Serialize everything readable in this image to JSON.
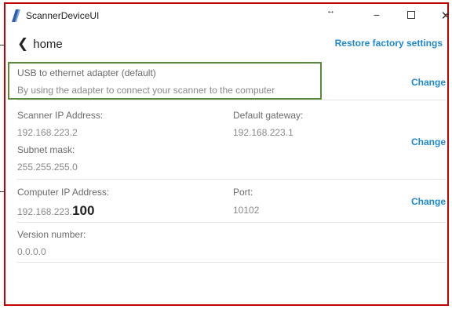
{
  "window": {
    "title": "ScannerDeviceUI",
    "resize_glyph": "↔",
    "minimize_glyph": "−",
    "maximize_glyph": "☐",
    "close_glyph": "✕",
    "icon": "app-logo-icon"
  },
  "nav": {
    "back_label": "home",
    "restore_label": "Restore factory settings"
  },
  "adapter": {
    "title": "USB to ethernet adapter (default)",
    "description": "By using the adapter to connect your scanner to the computer",
    "change_label": "Change"
  },
  "scanner": {
    "ip_label": "Scanner IP Address:",
    "ip_value": "192.168.223.2",
    "gateway_label": "Default gateway:",
    "gateway_value": "192.168.223.1",
    "subnet_label": "Subnet mask:",
    "subnet_value": "255.255.255.0",
    "change_label": "Change"
  },
  "computer": {
    "ip_label": "Computer IP Address:",
    "ip_prefix": "192.168.223.",
    "ip_suffix": "100",
    "port_label": "Port:",
    "port_value": "10102",
    "change_label": "Change"
  },
  "version": {
    "label": "Version number:",
    "value": "0.0.0.0"
  },
  "colors": {
    "accent": "#1e88d2",
    "frame": "#c00000",
    "highlight_box": "#5a8a3c"
  }
}
